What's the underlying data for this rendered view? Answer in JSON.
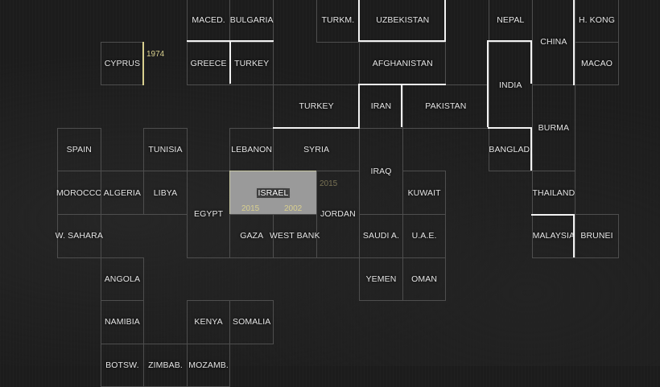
{
  "countries": [
    {
      "key": "maced",
      "label": "MACED."
    },
    {
      "key": "bulgaria",
      "label": "BULGARIA"
    },
    {
      "key": "turkm",
      "label": "TURKM."
    },
    {
      "key": "uzbekistan",
      "label": "UZBEKISTAN"
    },
    {
      "key": "nepal",
      "label": "NEPAL"
    },
    {
      "key": "china",
      "label": "CHINA"
    },
    {
      "key": "hkong",
      "label": "H. KONG"
    },
    {
      "key": "cyprus",
      "label": "CYPRUS"
    },
    {
      "key": "greece",
      "label": "GREECE"
    },
    {
      "key": "turkey_w",
      "label": "TURKEY"
    },
    {
      "key": "afghanistan",
      "label": "AFGHANISTAN"
    },
    {
      "key": "india",
      "label": "INDIA"
    },
    {
      "key": "macao",
      "label": "MACAO"
    },
    {
      "key": "turkey_e",
      "label": "TURKEY"
    },
    {
      "key": "iran",
      "label": "IRAN"
    },
    {
      "key": "pakistan",
      "label": "PAKISTAN"
    },
    {
      "key": "burma",
      "label": "BURMA"
    },
    {
      "key": "spain",
      "label": "SPAIN"
    },
    {
      "key": "tunisia",
      "label": "TUNISIA"
    },
    {
      "key": "lebanon",
      "label": "LEBANON"
    },
    {
      "key": "syria",
      "label": "SYRIA"
    },
    {
      "key": "bangladesh",
      "label": "BANGLAD."
    },
    {
      "key": "morocco",
      "label": "MOROCCO"
    },
    {
      "key": "algeria",
      "label": "ALGERIA"
    },
    {
      "key": "libya",
      "label": "LIBYA"
    },
    {
      "key": "egypt",
      "label": "EGYPT"
    },
    {
      "key": "israel",
      "label": "ISRAEL"
    },
    {
      "key": "iraq",
      "label": "IRAQ"
    },
    {
      "key": "kuwait",
      "label": "KUWAIT"
    },
    {
      "key": "thailand",
      "label": "THAILAND"
    },
    {
      "key": "jordan",
      "label": "JORDAN"
    },
    {
      "key": "wsahara",
      "label": "W. SAHARA"
    },
    {
      "key": "gaza",
      "label": "GAZA"
    },
    {
      "key": "westbank",
      "label": "WEST BANK"
    },
    {
      "key": "saudi",
      "label": "SAUDI A."
    },
    {
      "key": "uae",
      "label": "U.A.E."
    },
    {
      "key": "malaysia",
      "label": "MALAYSIA"
    },
    {
      "key": "brunei",
      "label": "BRUNEI"
    },
    {
      "key": "angola",
      "label": "ANGOLA"
    },
    {
      "key": "yemen",
      "label": "YEMEN"
    },
    {
      "key": "oman",
      "label": "OMAN"
    },
    {
      "key": "namibia",
      "label": "NAMIBIA"
    },
    {
      "key": "kenya",
      "label": "KENYA"
    },
    {
      "key": "somalia",
      "label": "SOMALIA"
    },
    {
      "key": "botsw",
      "label": "BOTSW."
    },
    {
      "key": "zimbab",
      "label": "ZIMBAB."
    },
    {
      "key": "mozamb",
      "label": "MOZAMB."
    }
  ],
  "highlighted_country": "israel",
  "year_labels": [
    {
      "key": "cyprus_1974",
      "text": "1974"
    },
    {
      "key": "israel_2015_right",
      "text": "2015"
    },
    {
      "key": "israel_2015_left",
      "text": "2015"
    },
    {
      "key": "israel_2002",
      "text": "2002"
    }
  ],
  "colors": {
    "background": "#1c1c1c",
    "cell_border": "#4e4e4e",
    "boundary_line": "#f2f2f2",
    "year_line": "#d8cf8e",
    "highlight_fill": "#9a9a9a"
  }
}
